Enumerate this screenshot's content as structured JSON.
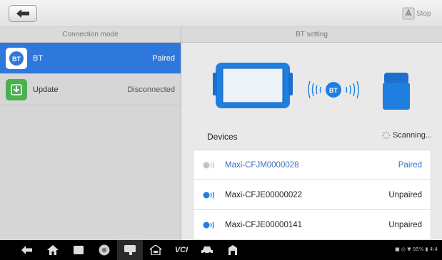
{
  "toolbar": {
    "back_icon": "back-arrow-icon",
    "stop_label": "Stop",
    "stop_icon": "stop-sign-icon"
  },
  "left_header": "Connection mode",
  "right_header": "BT setting",
  "modes": [
    {
      "name": "BT",
      "status": "Paired",
      "icon": "bt-badge-icon",
      "active": true,
      "icon_color": "#2f78db"
    },
    {
      "name": "Update",
      "status": "Disconnected",
      "icon": "update-download-icon",
      "active": false,
      "icon_color": "#4caf50"
    }
  ],
  "illustration": {
    "bt_badge": "BT",
    "tablet_color": "#1f7fe0",
    "vci_color": "#1f7fe0"
  },
  "devices_label": "Devices",
  "scanning_label": "Scanning...",
  "devices": [
    {
      "name": "Maxi-CFJM0000028",
      "status": "Paired",
      "icon": "device-connected-icon"
    },
    {
      "name": "Maxi-CFJE00000022",
      "status": "Unpaired",
      "icon": "device-bt-icon"
    },
    {
      "name": "Maxi-CFJE00000141",
      "status": "Unpaired",
      "icon": "device-bt-icon"
    }
  ],
  "navbar": {
    "items": [
      "back-icon",
      "home-icon",
      "recent-apps-icon",
      "chrome-icon",
      "maxisys-icon",
      "car-home-icon",
      "vci-icon",
      "car-icon",
      "vehicle-shop-icon"
    ],
    "vci_label": "VCI",
    "status_text": "■ ◎ ▼ 95% ▮ 4:4"
  },
  "colors": {
    "accent": "#2f78db",
    "bt_blue": "#1f7fe0",
    "paired_text": "#3a6fbd"
  }
}
